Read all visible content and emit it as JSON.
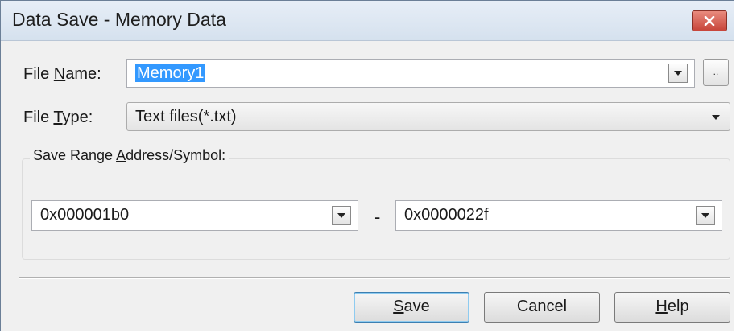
{
  "window": {
    "title": "Data Save - Memory Data"
  },
  "file_name": {
    "label_prefix": "File ",
    "label_mnemonic": "N",
    "label_rest": "ame:",
    "value": "Memory1",
    "browse_label": ".."
  },
  "file_type": {
    "label_prefix": "File ",
    "label_mnemonic": "T",
    "label_rest": "ype:",
    "selected": "Text files(*.txt)"
  },
  "save_range": {
    "group_prefix": "Save Range ",
    "group_mnemonic": "A",
    "group_rest": "ddress/Symbol:",
    "start_value": "0x000001b0",
    "separator": "-",
    "end_value": "0x0000022f"
  },
  "buttons": {
    "save_mnemonic": "S",
    "save_rest": "ave",
    "cancel": "Cancel",
    "help_mnemonic": "H",
    "help_rest": "elp"
  },
  "colors": {
    "selection": "#3399ff",
    "close_button": "#c7453a",
    "titlebar": "#d5e1ee"
  },
  "icons": {
    "close": "close-icon",
    "dropdown": "chevron-down-icon",
    "browse": "ellipsis-icon"
  }
}
